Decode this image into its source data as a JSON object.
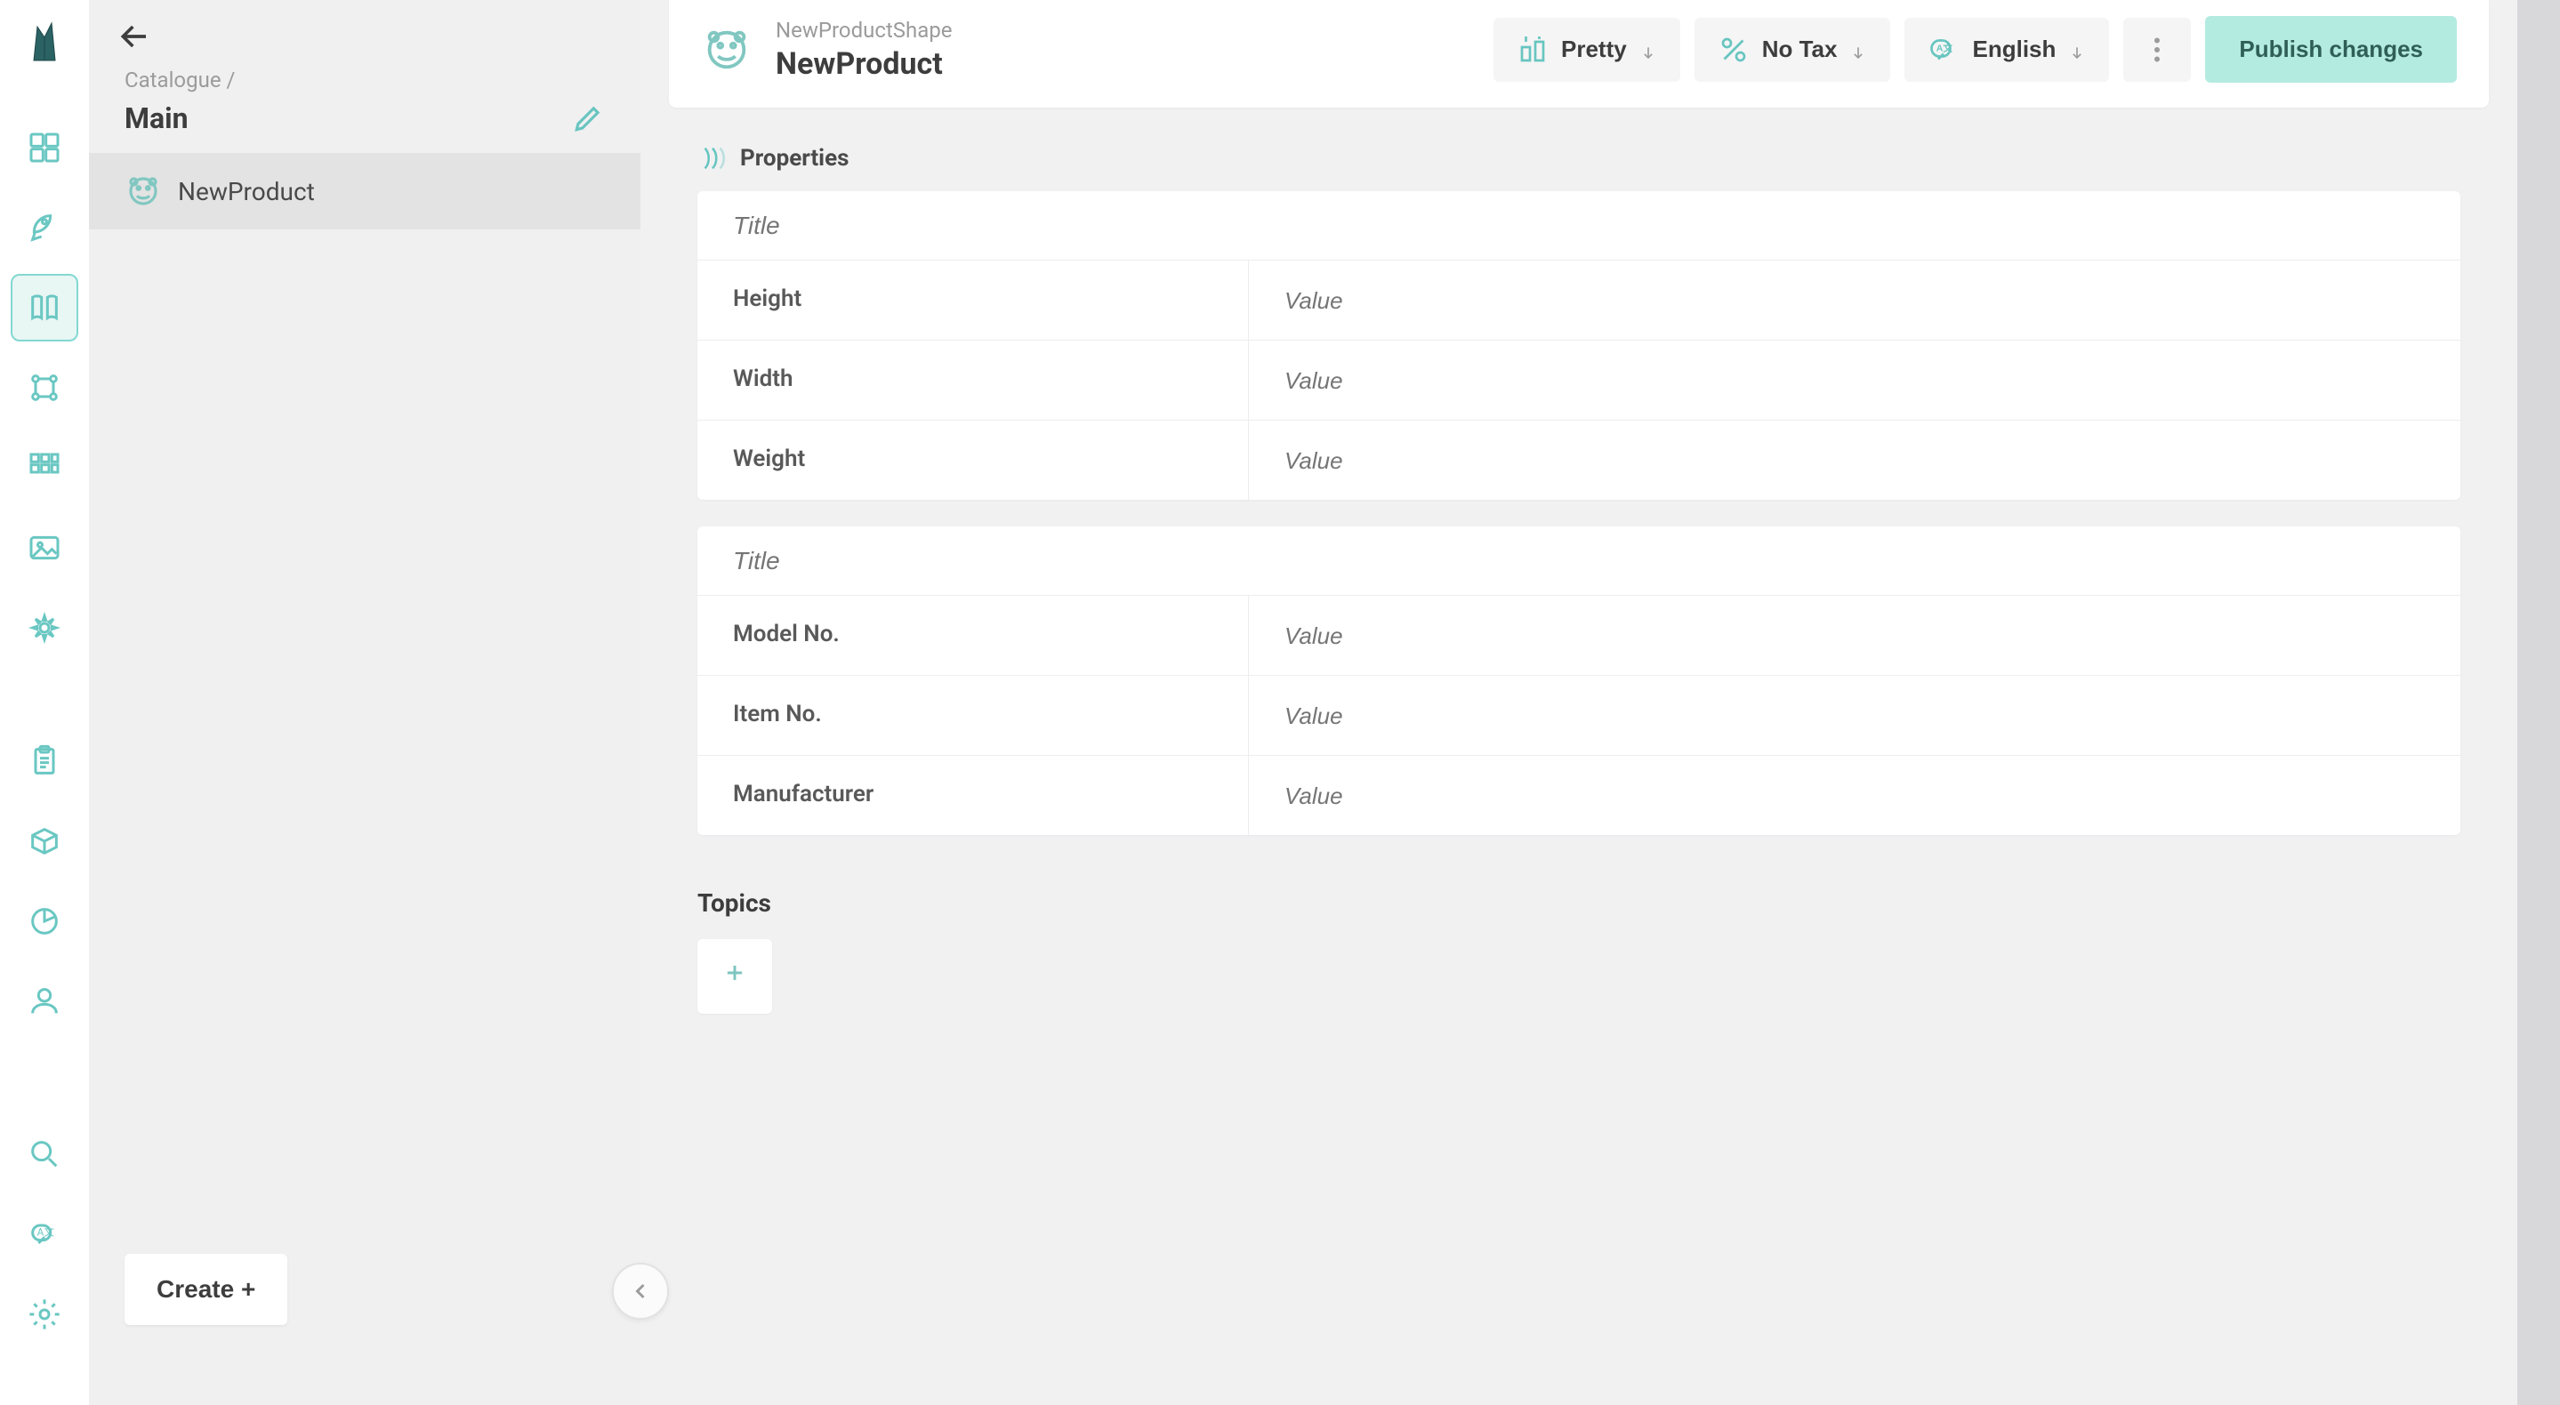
{
  "rail": {
    "icons": [
      "dashboard-icon",
      "rocket-icon",
      "catalogue-icon",
      "graph-icon",
      "grid-icon",
      "image-icon",
      "gear-flower-icon"
    ],
    "bottom_icons": [
      "clipboard-icon",
      "box-icon",
      "pie-icon",
      "user-icon"
    ],
    "footer_icons": [
      "search-icon",
      "lang-icon",
      "settings-icon"
    ],
    "active_index": 2
  },
  "tree": {
    "breadcrumb": "Catalogue  /",
    "title": "Main",
    "items": [
      {
        "label": "NewProduct"
      }
    ],
    "create_label": "Create +"
  },
  "header": {
    "shape_name": "NewProductShape",
    "product_name": "NewProduct",
    "toolbar": {
      "template_label": "Pretty",
      "tax_label": "No Tax",
      "language_label": "English",
      "publish_label": "Publish changes"
    }
  },
  "properties": {
    "section_title": "Properties",
    "title_placeholder": "Title",
    "value_placeholder": "Value",
    "groups": [
      {
        "rows": [
          "Height",
          "Width",
          "Weight"
        ]
      },
      {
        "rows": [
          "Model No.",
          "Item No.",
          "Manufacturer"
        ]
      }
    ]
  },
  "topics": {
    "title": "Topics"
  }
}
